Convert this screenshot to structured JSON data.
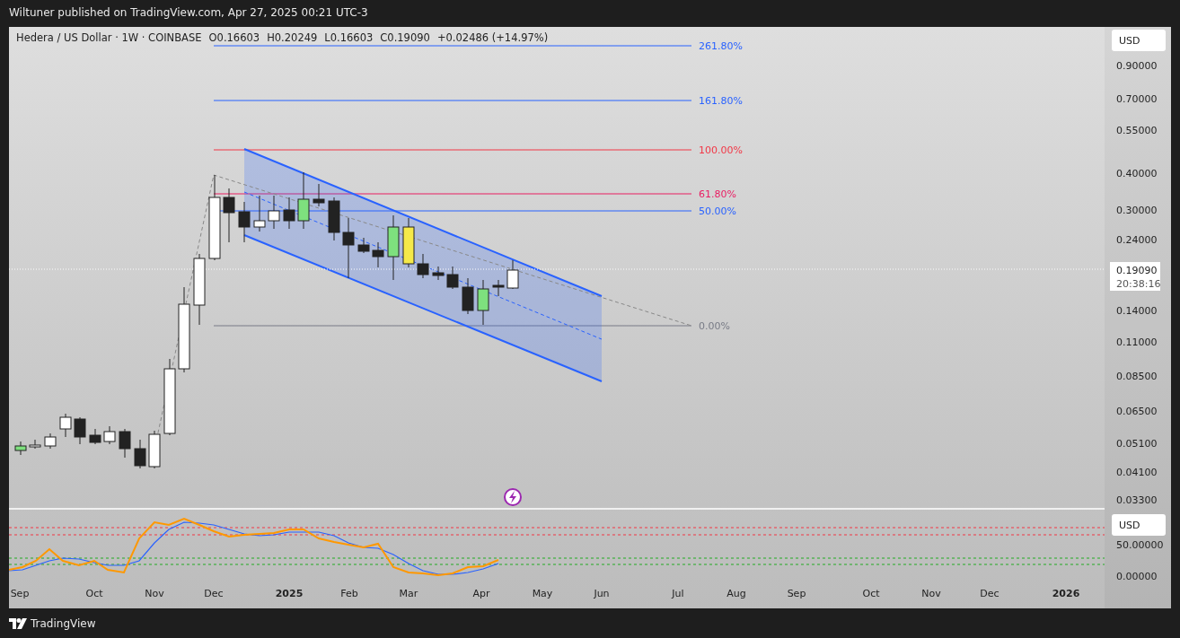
{
  "header": {
    "publisher_line": "Wiltuner published on TradingView.com, Apr 27, 2025 00:21 UTC-3"
  },
  "legend": {
    "symbol": "Hedera / US Dollar · 1W · COINBASE",
    "open": "O0.16603",
    "high": "H0.20249",
    "low": "L0.16603",
    "close": "C0.19090",
    "change": "+0.02486 (+14.97%)"
  },
  "price_axis": {
    "currency": "USD",
    "ticks": [
      "0.90000",
      "0.70000",
      "0.55000",
      "0.40000",
      "0.30000",
      "0.24000",
      "0.14000",
      "0.11000",
      "0.08500",
      "0.06500",
      "0.05100",
      "0.04100",
      "0.03300"
    ],
    "last_price": "0.19090",
    "countdown": "20:38:16"
  },
  "fib_levels": [
    {
      "label": "261.80%",
      "color": "#2962ff"
    },
    {
      "label": "161.80%",
      "color": "#2962ff"
    },
    {
      "label": "100.00%",
      "color": "#f23645"
    },
    {
      "label": "61.80%",
      "color": "#e91e63"
    },
    {
      "label": "50.00%",
      "color": "#2962ff"
    },
    {
      "label": "0.00%",
      "color": "#787b86"
    }
  ],
  "oscillator_axis": {
    "currency": "USD",
    "ticks": [
      "50.00000",
      "0.00000"
    ]
  },
  "time_axis": [
    {
      "label": "Sep",
      "kind": "month"
    },
    {
      "label": "Oct",
      "kind": "month"
    },
    {
      "label": "Nov",
      "kind": "month"
    },
    {
      "label": "Dec",
      "kind": "month"
    },
    {
      "label": "2025",
      "kind": "year"
    },
    {
      "label": "Feb",
      "kind": "month"
    },
    {
      "label": "Mar",
      "kind": "month"
    },
    {
      "label": "Apr",
      "kind": "month"
    },
    {
      "label": "May",
      "kind": "month"
    },
    {
      "label": "Jun",
      "kind": "month"
    },
    {
      "label": "Jul",
      "kind": "month"
    },
    {
      "label": "Aug",
      "kind": "month"
    },
    {
      "label": "Sep",
      "kind": "month"
    },
    {
      "label": "Oct",
      "kind": "month"
    },
    {
      "label": "Nov",
      "kind": "month"
    },
    {
      "label": "Dec",
      "kind": "month"
    },
    {
      "label": "2026",
      "kind": "year"
    }
  ],
  "footer": {
    "brand": "TradingView"
  }
}
